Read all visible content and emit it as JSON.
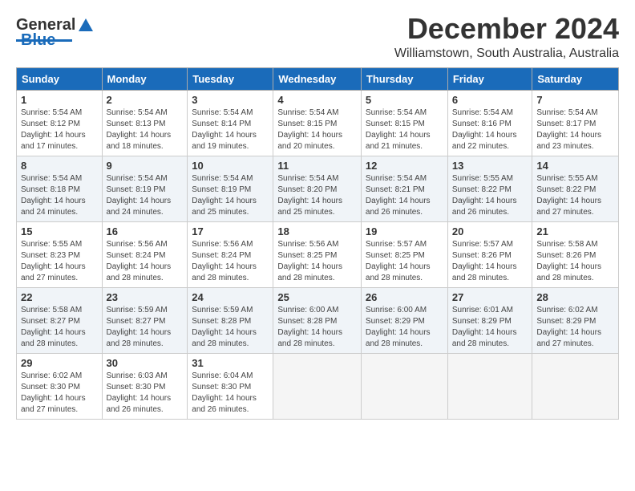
{
  "logo": {
    "text1": "General",
    "text2": "Blue"
  },
  "title": "December 2024",
  "location": "Williamstown, South Australia, Australia",
  "days_of_week": [
    "Sunday",
    "Monday",
    "Tuesday",
    "Wednesday",
    "Thursday",
    "Friday",
    "Saturday"
  ],
  "weeks": [
    [
      {
        "day": 1,
        "info": "Sunrise: 5:54 AM\nSunset: 8:12 PM\nDaylight: 14 hours\nand 17 minutes."
      },
      {
        "day": 2,
        "info": "Sunrise: 5:54 AM\nSunset: 8:13 PM\nDaylight: 14 hours\nand 18 minutes."
      },
      {
        "day": 3,
        "info": "Sunrise: 5:54 AM\nSunset: 8:14 PM\nDaylight: 14 hours\nand 19 minutes."
      },
      {
        "day": 4,
        "info": "Sunrise: 5:54 AM\nSunset: 8:15 PM\nDaylight: 14 hours\nand 20 minutes."
      },
      {
        "day": 5,
        "info": "Sunrise: 5:54 AM\nSunset: 8:15 PM\nDaylight: 14 hours\nand 21 minutes."
      },
      {
        "day": 6,
        "info": "Sunrise: 5:54 AM\nSunset: 8:16 PM\nDaylight: 14 hours\nand 22 minutes."
      },
      {
        "day": 7,
        "info": "Sunrise: 5:54 AM\nSunset: 8:17 PM\nDaylight: 14 hours\nand 23 minutes."
      }
    ],
    [
      {
        "day": 8,
        "info": "Sunrise: 5:54 AM\nSunset: 8:18 PM\nDaylight: 14 hours\nand 24 minutes."
      },
      {
        "day": 9,
        "info": "Sunrise: 5:54 AM\nSunset: 8:19 PM\nDaylight: 14 hours\nand 24 minutes."
      },
      {
        "day": 10,
        "info": "Sunrise: 5:54 AM\nSunset: 8:19 PM\nDaylight: 14 hours\nand 25 minutes."
      },
      {
        "day": 11,
        "info": "Sunrise: 5:54 AM\nSunset: 8:20 PM\nDaylight: 14 hours\nand 25 minutes."
      },
      {
        "day": 12,
        "info": "Sunrise: 5:54 AM\nSunset: 8:21 PM\nDaylight: 14 hours\nand 26 minutes."
      },
      {
        "day": 13,
        "info": "Sunrise: 5:55 AM\nSunset: 8:22 PM\nDaylight: 14 hours\nand 26 minutes."
      },
      {
        "day": 14,
        "info": "Sunrise: 5:55 AM\nSunset: 8:22 PM\nDaylight: 14 hours\nand 27 minutes."
      }
    ],
    [
      {
        "day": 15,
        "info": "Sunrise: 5:55 AM\nSunset: 8:23 PM\nDaylight: 14 hours\nand 27 minutes."
      },
      {
        "day": 16,
        "info": "Sunrise: 5:56 AM\nSunset: 8:24 PM\nDaylight: 14 hours\nand 28 minutes."
      },
      {
        "day": 17,
        "info": "Sunrise: 5:56 AM\nSunset: 8:24 PM\nDaylight: 14 hours\nand 28 minutes."
      },
      {
        "day": 18,
        "info": "Sunrise: 5:56 AM\nSunset: 8:25 PM\nDaylight: 14 hours\nand 28 minutes."
      },
      {
        "day": 19,
        "info": "Sunrise: 5:57 AM\nSunset: 8:25 PM\nDaylight: 14 hours\nand 28 minutes."
      },
      {
        "day": 20,
        "info": "Sunrise: 5:57 AM\nSunset: 8:26 PM\nDaylight: 14 hours\nand 28 minutes."
      },
      {
        "day": 21,
        "info": "Sunrise: 5:58 AM\nSunset: 8:26 PM\nDaylight: 14 hours\nand 28 minutes."
      }
    ],
    [
      {
        "day": 22,
        "info": "Sunrise: 5:58 AM\nSunset: 8:27 PM\nDaylight: 14 hours\nand 28 minutes."
      },
      {
        "day": 23,
        "info": "Sunrise: 5:59 AM\nSunset: 8:27 PM\nDaylight: 14 hours\nand 28 minutes."
      },
      {
        "day": 24,
        "info": "Sunrise: 5:59 AM\nSunset: 8:28 PM\nDaylight: 14 hours\nand 28 minutes."
      },
      {
        "day": 25,
        "info": "Sunrise: 6:00 AM\nSunset: 8:28 PM\nDaylight: 14 hours\nand 28 minutes."
      },
      {
        "day": 26,
        "info": "Sunrise: 6:00 AM\nSunset: 8:29 PM\nDaylight: 14 hours\nand 28 minutes."
      },
      {
        "day": 27,
        "info": "Sunrise: 6:01 AM\nSunset: 8:29 PM\nDaylight: 14 hours\nand 28 minutes."
      },
      {
        "day": 28,
        "info": "Sunrise: 6:02 AM\nSunset: 8:29 PM\nDaylight: 14 hours\nand 27 minutes."
      }
    ],
    [
      {
        "day": 29,
        "info": "Sunrise: 6:02 AM\nSunset: 8:30 PM\nDaylight: 14 hours\nand 27 minutes."
      },
      {
        "day": 30,
        "info": "Sunrise: 6:03 AM\nSunset: 8:30 PM\nDaylight: 14 hours\nand 26 minutes."
      },
      {
        "day": 31,
        "info": "Sunrise: 6:04 AM\nSunset: 8:30 PM\nDaylight: 14 hours\nand 26 minutes."
      },
      null,
      null,
      null,
      null
    ]
  ]
}
